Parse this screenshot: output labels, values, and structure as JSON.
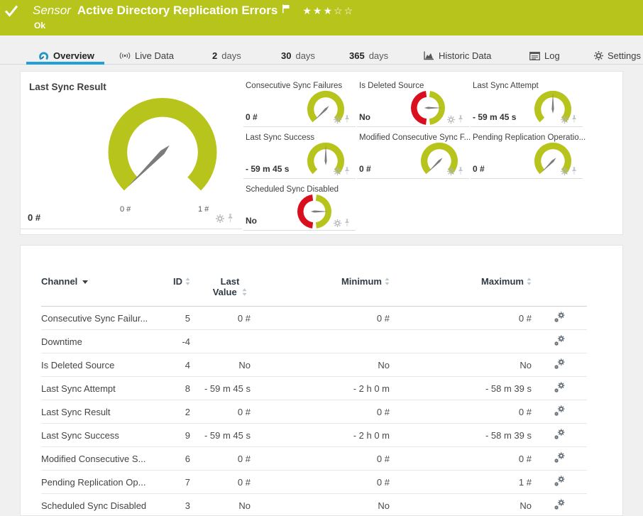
{
  "colors": {
    "brand_green": "#b7c41c",
    "status_red": "#d90f1e",
    "accent_blue": "#22a0d8",
    "needle_gray": "#7c7c7c"
  },
  "icons": {
    "status_check": "checkmark",
    "flag": "flag",
    "rating_filled_star": "★",
    "rating_empty_star": "☆",
    "overview_tab": "gauge",
    "live_data_tab": "broadcast-waves",
    "historic_tab": "area-chart",
    "log_tab": "log-list",
    "settings_tab": "gear",
    "cell_settings": "gear",
    "cell_pin": "pushpin",
    "row_edit": "double-gear",
    "sort": "up-down-triangles"
  },
  "header": {
    "kind": "Sensor",
    "title": "Active Directory Replication Errors",
    "status": "Ok",
    "rating": {
      "filled": "★★★",
      "empty": "☆☆"
    }
  },
  "tabs": {
    "overview": "Overview",
    "live_data": "Live Data",
    "days2": {
      "num": "2",
      "unit": "days"
    },
    "days30": {
      "num": "30",
      "unit": "days"
    },
    "days365": {
      "num": "365",
      "unit": "days"
    },
    "historic": "Historic Data",
    "log": "Log",
    "settings": "Settings"
  },
  "gauges": {
    "main": {
      "title": "Last Sync Result",
      "value": "0 #",
      "scale_min": "0 #",
      "scale_max": "1 #",
      "gauge_type": "green-270-arc",
      "needle": "min"
    },
    "cells": [
      {
        "title": "Consecutive Sync Failures",
        "value": "0 #",
        "gauge_type": "green-270-arc",
        "needle": "min"
      },
      {
        "title": "Is Deleted Source",
        "value": "No",
        "gauge_type": "red-green-ring",
        "needle": "right"
      },
      {
        "title": "Last Sync Attempt",
        "value": "- 59 m 45 s",
        "gauge_type": "green-270-arc",
        "needle": "up"
      },
      {
        "title": "Last Sync Success",
        "value": "- 59 m 45 s",
        "gauge_type": "green-270-arc",
        "needle": "up"
      },
      {
        "title": "Modified Consecutive Sync F...",
        "value": "0 #",
        "gauge_type": "green-270-arc",
        "needle": "min"
      },
      {
        "title": "Pending Replication Operatio...",
        "value": "0 #",
        "gauge_type": "green-270-arc",
        "needle": "min"
      },
      {
        "title": "Scheduled Sync Disabled",
        "value": "No",
        "gauge_type": "red-green-ring",
        "needle": "right"
      }
    ]
  },
  "channels": {
    "columns": [
      "Channel",
      "ID",
      "Last Value",
      "Minimum",
      "Maximum"
    ],
    "rows": [
      {
        "name": "Consecutive Sync Failur...",
        "id": "5",
        "last": "0 #",
        "min": "0 #",
        "max": "0 #"
      },
      {
        "name": "Downtime",
        "id": "-4",
        "last": "",
        "min": "",
        "max": ""
      },
      {
        "name": "Is Deleted Source",
        "id": "4",
        "last": "No",
        "min": "No",
        "max": "No"
      },
      {
        "name": "Last Sync Attempt",
        "id": "8",
        "last": "- 59 m 45 s",
        "min": "- 2 h 0 m",
        "max": "- 58 m 39 s"
      },
      {
        "name": "Last Sync Result",
        "id": "2",
        "last": "0 #",
        "min": "0 #",
        "max": "0 #"
      },
      {
        "name": "Last Sync Success",
        "id": "9",
        "last": "- 59 m 45 s",
        "min": "- 2 h 0 m",
        "max": "- 58 m 39 s"
      },
      {
        "name": "Modified Consecutive S...",
        "id": "6",
        "last": "0 #",
        "min": "0 #",
        "max": "0 #"
      },
      {
        "name": "Pending Replication Op...",
        "id": "7",
        "last": "0 #",
        "min": "0 #",
        "max": "1 #"
      },
      {
        "name": "Scheduled Sync Disabled",
        "id": "3",
        "last": "No",
        "min": "No",
        "max": "No"
      }
    ]
  }
}
